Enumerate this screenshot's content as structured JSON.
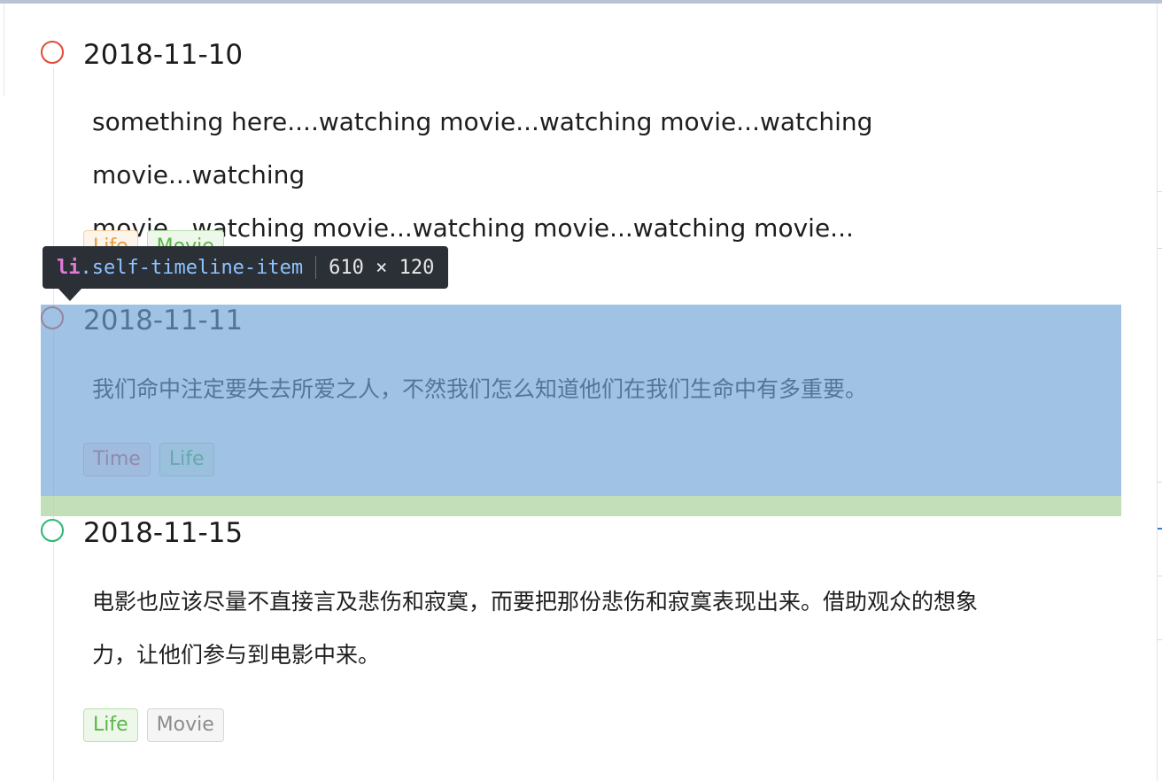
{
  "timeline": {
    "items": [
      {
        "date": "2018-11-10",
        "dot_color": "#e24a3a",
        "content_lines": [
          "something here....watching movie...watching movie...watching movie...watching",
          "movie...watching movie...watching movie...watching movie..."
        ],
        "tags": [
          {
            "label": "Life",
            "color": "#e89a3c"
          },
          {
            "label": "Movie",
            "color": "#5ab54a"
          }
        ]
      },
      {
        "date": "2018-11-11",
        "dot_color": "#e24a3a",
        "content_lines": [
          "我们命中注定要失去所爱之人，不然我们怎么知道他们在我们生命中有多重要。"
        ],
        "tags": [
          {
            "label": "Time",
            "color": "#d45a5a"
          },
          {
            "label": "Life",
            "color": "#5ab54a"
          }
        ]
      },
      {
        "date": "2018-11-15",
        "dot_color": "#2bb673",
        "content_lines": [
          "电影也应该尽量不直接言及悲伤和寂寞，而要把那份悲伤和寂寞表现出来。借助观众的想象",
          "力，让他们参与到电影中来。"
        ],
        "tags": [
          {
            "label": "Life",
            "color": "#5ab54a"
          },
          {
            "label": "Movie",
            "color": "#8c8c8c"
          }
        ]
      }
    ]
  },
  "devtools_tooltip": {
    "tag": "li",
    "class_name": ".self-timeline-item",
    "dimensions": "610 × 120",
    "highlight_color": "#6fa2d8",
    "margin_color": "#acd39e"
  }
}
